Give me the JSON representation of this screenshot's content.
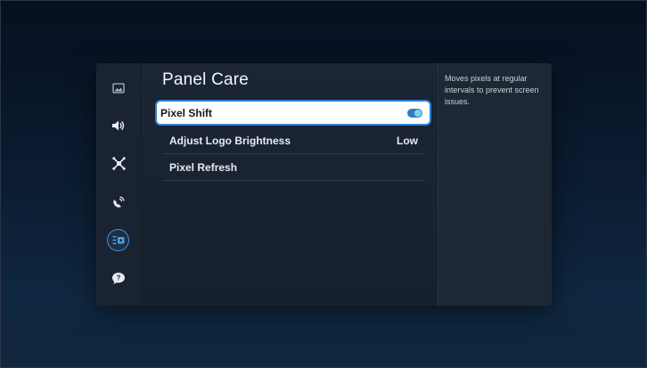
{
  "page_title": "Panel Care",
  "side_nav": [
    {
      "icon": "picture-icon",
      "selected": false
    },
    {
      "icon": "sound-icon",
      "selected": false
    },
    {
      "icon": "connection-icon",
      "selected": false
    },
    {
      "icon": "broadcast-icon",
      "selected": false
    },
    {
      "icon": "general-settings-icon",
      "selected": true
    },
    {
      "icon": "support-icon",
      "selected": false
    }
  ],
  "menu": {
    "pixel_shift": {
      "label": "Pixel Shift",
      "toggle_state": "on"
    },
    "adjust_logo_brightness": {
      "label": "Adjust Logo Brightness",
      "value": "Low"
    },
    "pixel_refresh": {
      "label": "Pixel Refresh"
    }
  },
  "description": "Moves pixels at regular intervals to prevent screen issues.",
  "colors": {
    "accent": "#2d7fd0",
    "toggle_on": "#2f7fbf",
    "panel_bg": "#1b2533"
  }
}
